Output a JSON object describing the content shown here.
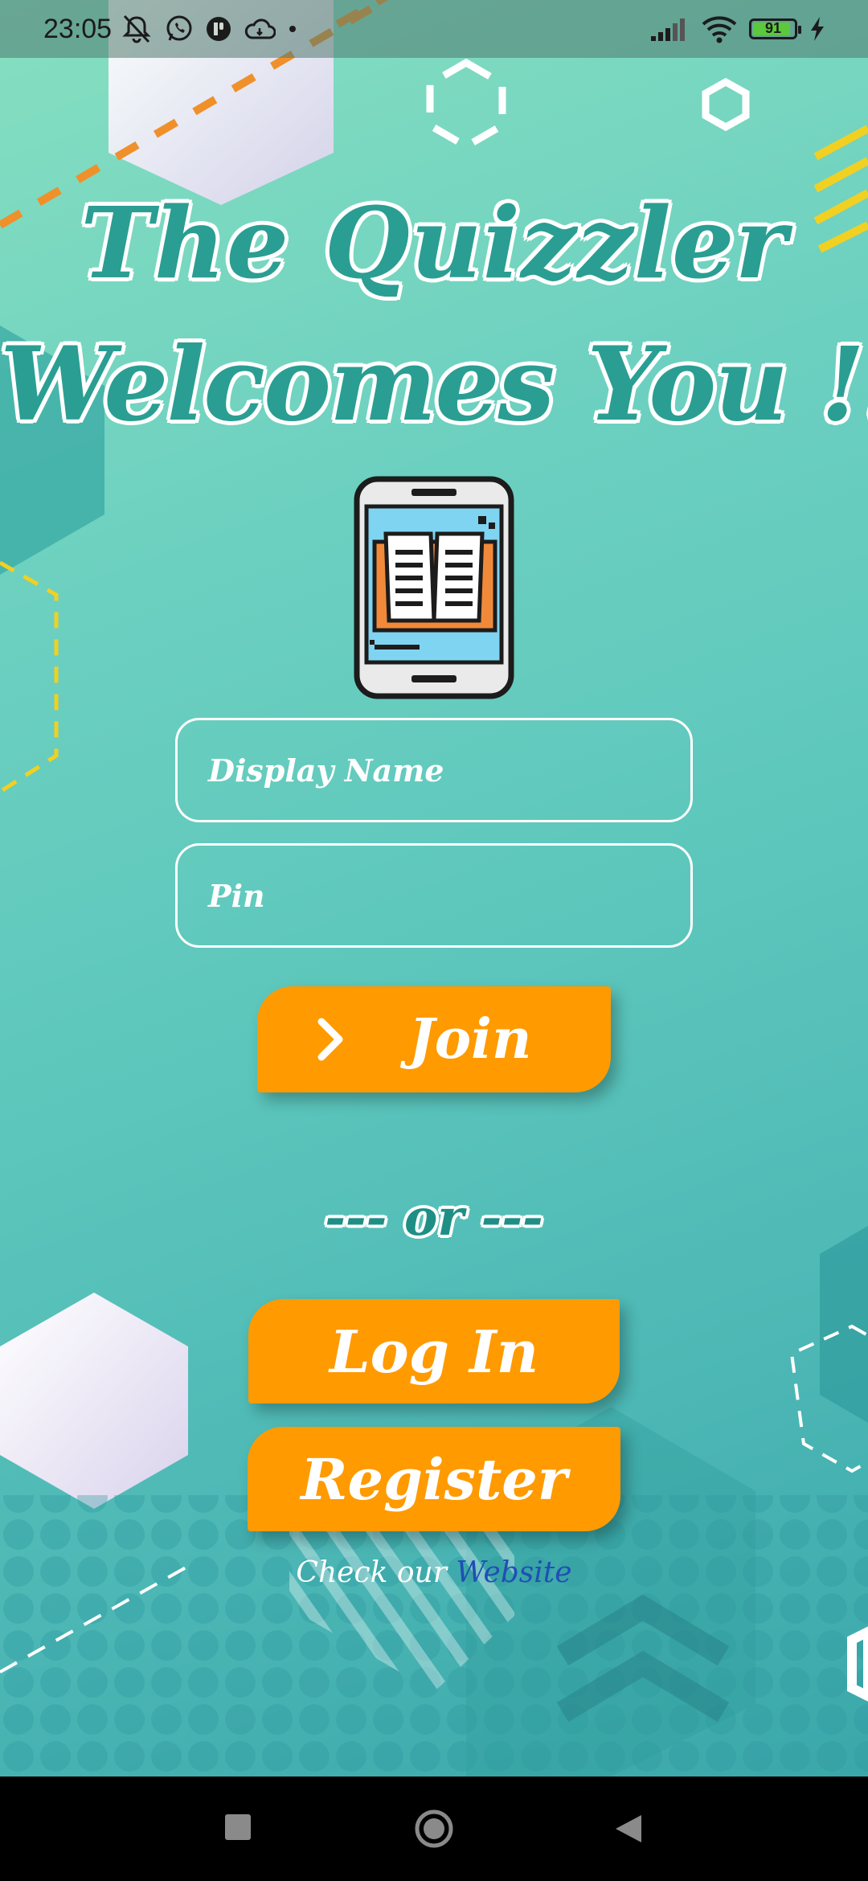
{
  "status_bar": {
    "time": "23:05",
    "battery_level": "91",
    "battery_fraction": 0.91,
    "left_icons": [
      "muted-bell-icon",
      "whatsapp-icon",
      "app-icon",
      "cloud-icon",
      "dot-icon"
    ],
    "right_icons": [
      "signal-icon",
      "wifi-icon",
      "battery-icon",
      "charging-bolt-icon"
    ]
  },
  "title": {
    "line1": "The Quizzler",
    "line2": "Welcomes You !!!"
  },
  "logo": {
    "icon": "phone-book-icon"
  },
  "form": {
    "display_name_placeholder": "Display Name",
    "pin_placeholder": "Pin",
    "join_label": "Join",
    "join_icon": "chevron-right-icon"
  },
  "divider": {
    "text": "--- or ---"
  },
  "actions": {
    "login_label": "Log In",
    "register_label": "Register"
  },
  "footer": {
    "prefix": "Check our ",
    "link_text": "Website"
  },
  "nav": {
    "icons": [
      "recents-icon",
      "home-icon",
      "back-icon"
    ]
  },
  "colors": {
    "accent": "#ff9a00",
    "title_teal": "#2a9e92",
    "link_blue": "#1f4fb5",
    "bg_top": "#86dfc0",
    "bg_bottom": "#3aa7aa"
  }
}
